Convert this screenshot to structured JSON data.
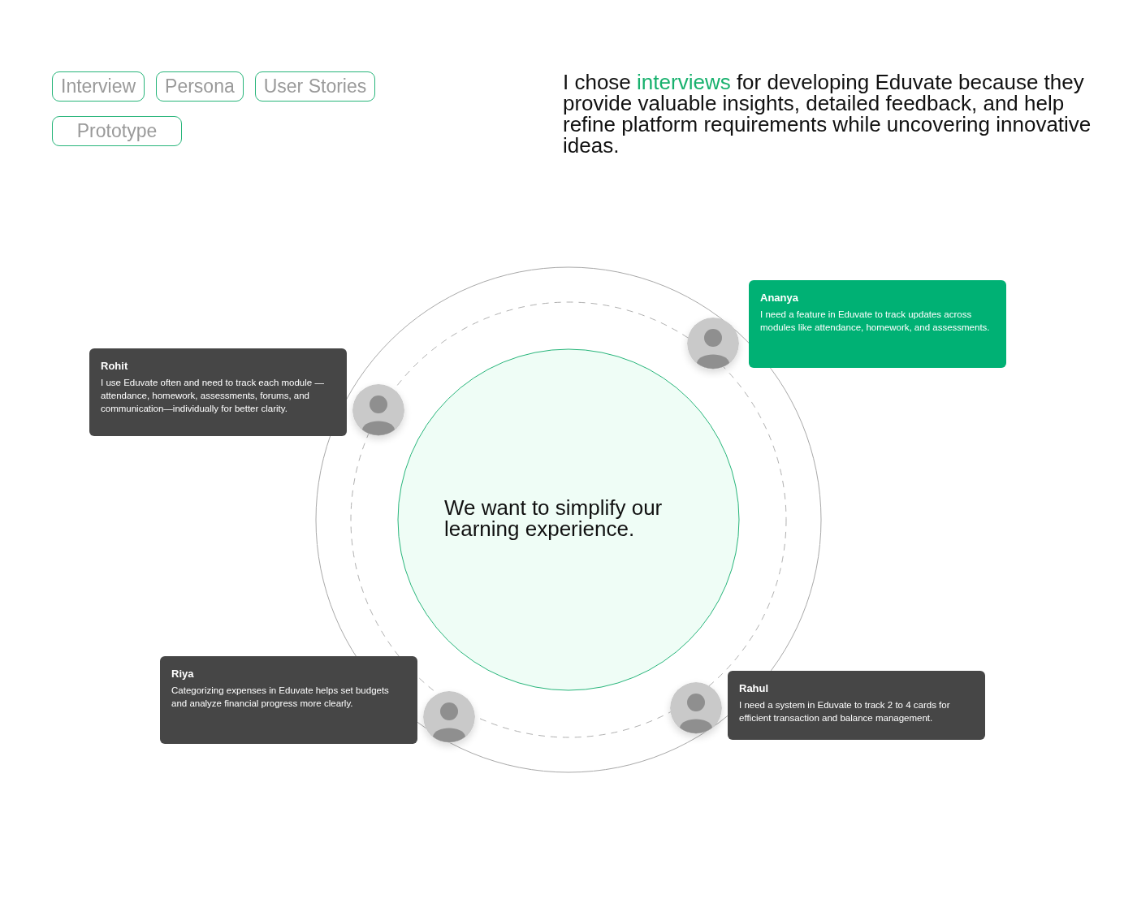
{
  "tags": [
    {
      "label": "Interview"
    },
    {
      "label": "Persona"
    },
    {
      "label": "User Stories"
    },
    {
      "label": "Prototype"
    }
  ],
  "headline": [
    {
      "text": "I chose ",
      "accent": false
    },
    {
      "text": "interviews",
      "accent": true
    },
    {
      "text": " for developing Eduvate because they provide valuable insights, detailed feedback, and help refine platform requirements while uncovering innovative ideas.",
      "accent": false
    }
  ],
  "center_text": "We want to simplify our learning experience.",
  "personas": [
    {
      "name": "Ananya",
      "quote": "I need a feature in Eduvate to track updates across modules like attendance, homework, and assessments.",
      "highlighted": true
    },
    {
      "name": "Rohit",
      "quote": "I use Eduvate often and need to track each module —attendance, homework, assessments, forums, and communication—individually for better clarity.",
      "highlighted": false
    },
    {
      "name": "Riya",
      "quote": "Categorizing expenses in Eduvate helps set budgets and analyze financial progress more clearly.",
      "highlighted": false
    },
    {
      "name": "Rahul",
      "quote": "I need a system in Eduvate to track 2 to 4 cards for efficient transaction and balance management.",
      "highlighted": false
    }
  ]
}
